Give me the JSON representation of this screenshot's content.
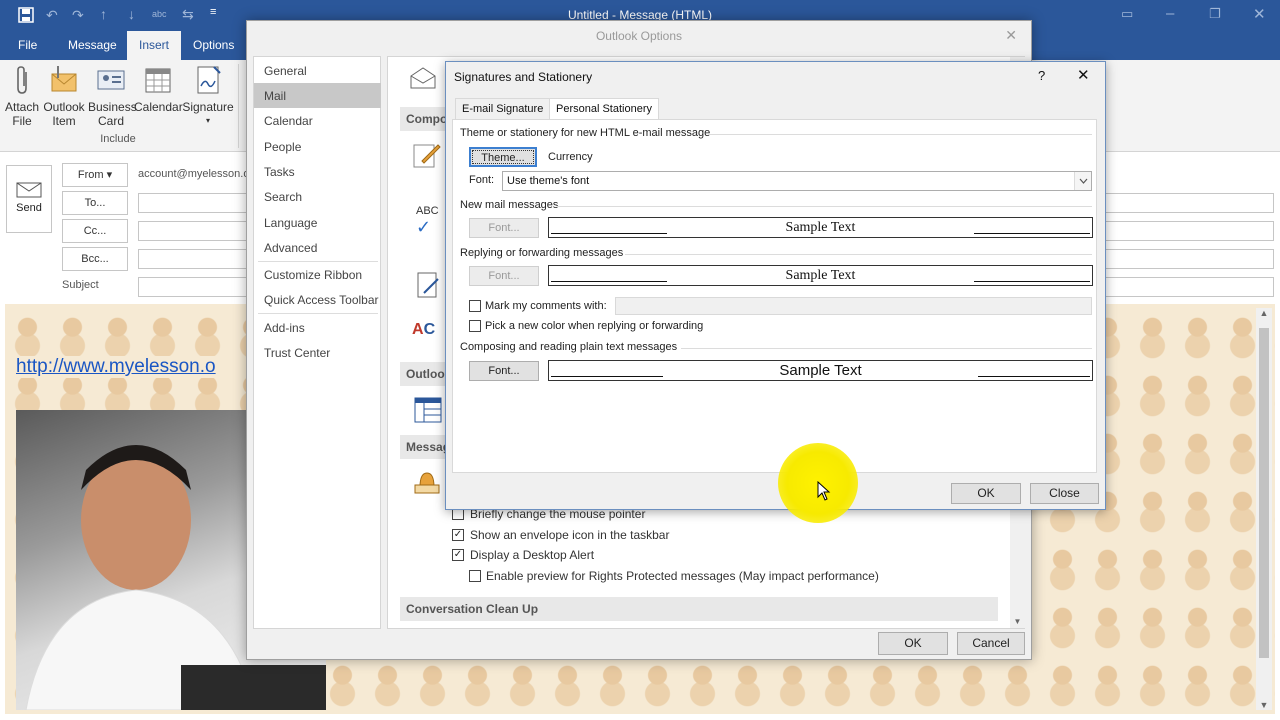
{
  "window": {
    "title": "Untitled  -  Message (HTML)"
  },
  "ribbon": {
    "tabs": [
      "File",
      "Message",
      "Insert",
      "Options"
    ],
    "active_tab": "Insert",
    "buttons": [
      {
        "label": "Attach\nFile",
        "icon": "paperclip-icon"
      },
      {
        "label": "Outlook\nItem",
        "icon": "envelope-clip-icon"
      },
      {
        "label": "Business\nCard",
        "icon": "business-card-icon"
      },
      {
        "label": "Calendar",
        "icon": "calendar-icon"
      },
      {
        "label": "Signature",
        "icon": "signature-icon"
      }
    ],
    "group_label": "Include"
  },
  "compose": {
    "send_label": "Send",
    "from_label": "From ▾",
    "from_value": "account@myelesson.o",
    "to_label": "To...",
    "cc_label": "Cc...",
    "bcc_label": "Bcc...",
    "subject_label": "Subject",
    "link_text": "http://www.myelesson.o"
  },
  "options_dialog": {
    "title": "Outlook Options",
    "nav": [
      "General",
      "Mail",
      "Calendar",
      "People",
      "Tasks",
      "Search",
      "Language",
      "Advanced",
      "Customize Ribbon",
      "Quick Access Toolbar",
      "Add-ins",
      "Trust Center"
    ],
    "selected": "Mail",
    "sections": {
      "compose": "Compos",
      "outlook": "Outlook",
      "message": "Messag",
      "cleanup": "Conversation Clean Up"
    },
    "checks": [
      {
        "label": "Briefly change the mouse pointer",
        "checked": false
      },
      {
        "label": "Show an envelope icon in the taskbar",
        "checked": true
      },
      {
        "label": "Display a Desktop Alert",
        "checked": true
      },
      {
        "label": "Enable preview for Rights Protected messages (May impact performance)",
        "checked": false
      }
    ],
    "ok": "OK",
    "cancel": "Cancel"
  },
  "sig_dialog": {
    "title": "Signatures and Stationery",
    "help": "?",
    "tabs": [
      "E-mail Signature",
      "Personal Stationery"
    ],
    "active_tab": "Personal Stationery",
    "theme_group": "Theme or stationery for new HTML e-mail message",
    "theme_button": "Theme...",
    "theme_value": "Currency",
    "font_label": "Font:",
    "font_value": "Use theme's font",
    "new_mail_group": "New mail messages",
    "reply_group": "Replying or forwarding messages",
    "plain_group": "Composing and reading plain text messages",
    "font_button": "Font...",
    "sample": "Sample Text",
    "mark_comments": "Mark my comments with:",
    "mark_comments_checked": false,
    "pick_color": "Pick a new color when replying or forwarding",
    "pick_color_checked": false,
    "ok": "OK",
    "close": "Close"
  }
}
